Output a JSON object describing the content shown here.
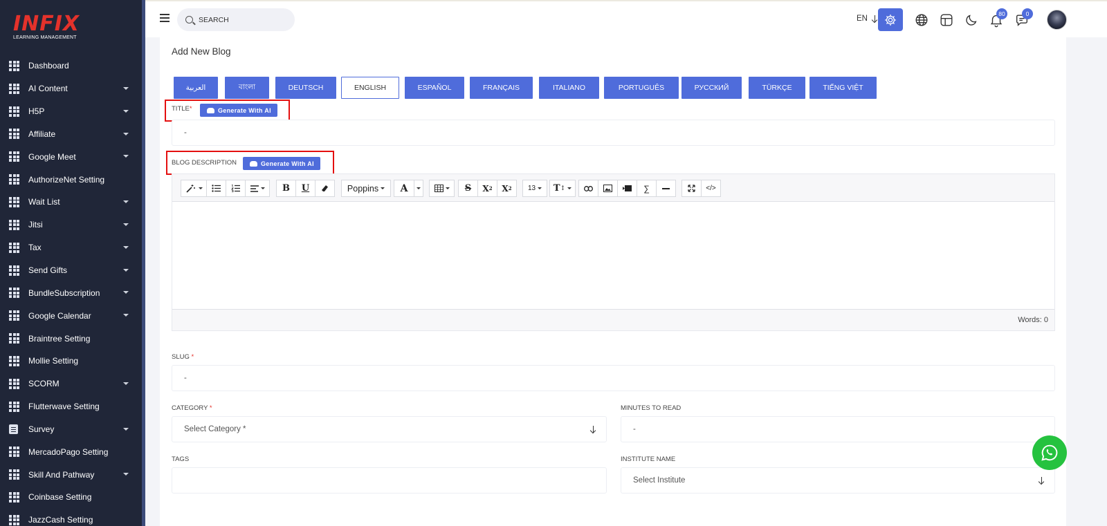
{
  "brand": {
    "name": "INFIX",
    "subtitle": "LEARNING MANAGEMENT"
  },
  "sidebar": {
    "items": [
      {
        "label": "Dashboard",
        "icon": "grid-icon",
        "has_submenu": false
      },
      {
        "label": "AI Content",
        "icon": "grid-icon",
        "has_submenu": true
      },
      {
        "label": "H5P",
        "icon": "grid-icon",
        "has_submenu": true
      },
      {
        "label": "Affiliate",
        "icon": "grid-icon",
        "has_submenu": true
      },
      {
        "label": "Google Meet",
        "icon": "grid-icon",
        "has_submenu": true
      },
      {
        "label": "AuthorizeNet Setting",
        "icon": "grid-icon",
        "has_submenu": false
      },
      {
        "label": "Wait List",
        "icon": "grid-icon",
        "has_submenu": true
      },
      {
        "label": "Jitsi",
        "icon": "grid-icon",
        "has_submenu": true
      },
      {
        "label": "Tax",
        "icon": "grid-icon",
        "has_submenu": true
      },
      {
        "label": "Send Gifts",
        "icon": "grid-icon",
        "has_submenu": true
      },
      {
        "label": "BundleSubscription",
        "icon": "grid-icon",
        "has_submenu": true
      },
      {
        "label": "Google Calendar",
        "icon": "grid-icon",
        "has_submenu": true
      },
      {
        "label": "Braintree Setting",
        "icon": "grid-icon",
        "has_submenu": false
      },
      {
        "label": "Mollie Setting",
        "icon": "grid-icon",
        "has_submenu": false
      },
      {
        "label": "SCORM",
        "icon": "grid-icon",
        "has_submenu": true
      },
      {
        "label": "Flutterwave Setting",
        "icon": "grid-icon",
        "has_submenu": false
      },
      {
        "label": "Survey",
        "icon": "document-icon",
        "has_submenu": true
      },
      {
        "label": "MercadoPago Setting",
        "icon": "grid-icon",
        "has_submenu": false
      },
      {
        "label": "Skill And Pathway",
        "icon": "grid-icon",
        "has_submenu": true
      },
      {
        "label": "Coinbase Setting",
        "icon": "grid-icon",
        "has_submenu": false
      },
      {
        "label": "JazzCash Setting",
        "icon": "grid-icon",
        "has_submenu": false
      }
    ]
  },
  "header": {
    "search_placeholder": "SEARCH",
    "language": "EN",
    "notifications_count": "80",
    "messages_count": "0",
    "accent_color": "#4f6cdb"
  },
  "page": {
    "title": "Add New Blog"
  },
  "language_tabs": [
    {
      "label": "العربية",
      "active": false
    },
    {
      "label": "বাংলা",
      "active": false
    },
    {
      "label": "DEUTSCH",
      "active": false
    },
    {
      "label": "ENGLISH",
      "active": true
    },
    {
      "label": "ESPAÑOL",
      "active": false
    },
    {
      "label": "FRANÇAIS",
      "active": false
    },
    {
      "label": "ITALIANO",
      "active": false
    },
    {
      "label": "PORTUGUÊS",
      "active": false
    },
    {
      "label": "РУССКИЙ",
      "active": false
    },
    {
      "label": "TÜRKÇE",
      "active": false
    },
    {
      "label": "TIẾNG VIỆT",
      "active": false
    }
  ],
  "form": {
    "title_label": "TITLE",
    "title_placeholder": "-",
    "generate_ai_label": "Generate With AI",
    "description_label": "BLOG DESCRIPTION",
    "slug_label": "SLUG",
    "slug_placeholder": "-",
    "category_label": "CATEGORY",
    "category_value": "Select Category *",
    "minutes_label": "MINUTES TO READ",
    "minutes_placeholder": "-",
    "tags_label": "TAGS",
    "tags_value": "",
    "institute_label": "INSTITUTE NAME",
    "institute_value": "Select Institute",
    "required_mark": "*"
  },
  "editor": {
    "font_family": "Poppins",
    "font_size": "13",
    "word_count": "Words: 0",
    "tools": [
      "magic-icon",
      "bullet-list-icon",
      "numbered-list-icon",
      "align-icon",
      "bold-icon",
      "underline-icon",
      "eraser-icon",
      "font-dropdown",
      "text-color-icon",
      "table-icon",
      "strikethrough-icon",
      "superscript-icon",
      "subscript-icon",
      "font-size-dropdown",
      "line-height-icon",
      "link-icon",
      "image-icon",
      "video-icon",
      "sigma-icon",
      "horizontal-rule-icon",
      "fullscreen-icon",
      "code-view-icon"
    ]
  }
}
